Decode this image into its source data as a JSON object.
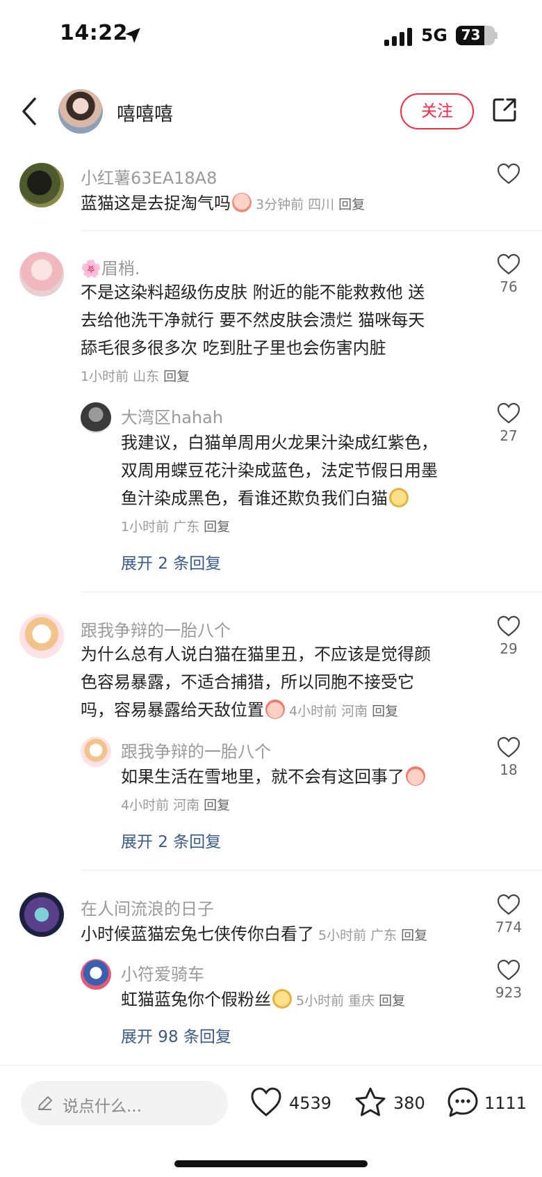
{
  "status_bar": {
    "time": "14:22",
    "network": "5G",
    "battery": "73",
    "battery_level": 0.73
  },
  "header": {
    "author_name": "嘻嘻嘻",
    "follow_label": "关注"
  },
  "comments": [
    {
      "user": "小红薯63EA18A8",
      "text": "蓝猫这是去捉淘气吗",
      "meta": "3分钟前 四川",
      "reply": "回复",
      "likes": ""
    },
    {
      "user_prefix": "🌸",
      "user": "眉梢.",
      "line1": "不是这染料超级伤皮肤  附近的能不能救救他  送",
      "line2": "去给他洗干净就行  要不然皮肤会溃烂  猫咪每天",
      "line3": "舔毛很多很多次  吃到肚子里也会伤害内脏",
      "meta": "1小时前 山东",
      "reply": "回复",
      "likes": "76",
      "sub": {
        "user": "大湾区hahah",
        "line1": "我建议，白猫单周用火龙果汁染成红紫色，",
        "line2": "双周用蝶豆花汁染成蓝色，法定节假日用墨",
        "line3": "鱼汁染成黑色，看谁还欺负我们白猫",
        "meta": "1小时前 广东",
        "reply": "回复",
        "likes": "27"
      },
      "expand": "展开 2 条回复"
    },
    {
      "user": "跟我争辩的一胎八个",
      "line1": "为什么总有人说白猫在猫里丑，不应该是觉得颜",
      "line2": "色容易暴露，不适合捕猎，所以同胞不接受它",
      "line3": "吗，容易暴露给天敌位置",
      "meta": "4小时前 河南",
      "reply": "回复",
      "likes": "29",
      "sub": {
        "user": "跟我争辩的一胎八个",
        "text": "如果生活在雪地里，就不会有这回事了",
        "meta": "4小时前 河南",
        "reply": "回复",
        "likes": "18"
      },
      "expand": "展开 2 条回复"
    },
    {
      "user": "在人间流浪的日子",
      "text": "小时候蓝猫宏兔七侠传你白看了",
      "meta": "5小时前 广东",
      "reply": "回复",
      "likes": "774",
      "sub": {
        "user": "小符爱骑车",
        "text": "虹猫蓝兔你个假粉丝",
        "meta": "5小时前 重庆",
        "reply": "回复",
        "likes": "923"
      },
      "expand": "展开 98 条回复"
    }
  ],
  "bottom_bar": {
    "input_placeholder": "说点什么...",
    "likes": "4539",
    "favorites": "380",
    "comments": "1111"
  },
  "colors": {
    "accent": "#ff2442",
    "link": "#3a5a8c",
    "muted": "#9a9a9a"
  }
}
